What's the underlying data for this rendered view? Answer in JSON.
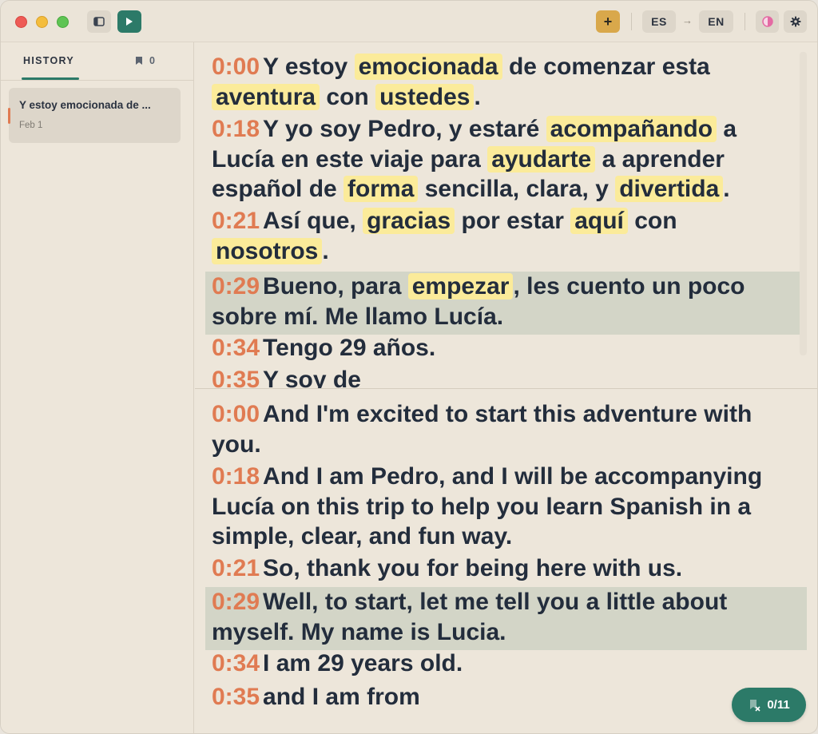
{
  "toolbar": {
    "source_lang": "ES",
    "arrow": "→",
    "target_lang": "EN",
    "add_label": "+",
    "accent": "#2c7a68",
    "add_color": "#d9a84b"
  },
  "sidebar": {
    "tab_history": "HISTORY",
    "bookmark_count": "0",
    "history": [
      {
        "title": "Y estoy emocionada de ...",
        "date": "Feb 1"
      }
    ]
  },
  "transcript": {
    "timestamp_color": "#e07b52",
    "highlight_color": "#fbeb9a",
    "spanish": [
      {
        "time": "0:00",
        "parts": [
          {
            "text": "Y estoy "
          },
          {
            "text": "emocionada",
            "hl": true
          },
          {
            "text": " de comenzar esta "
          },
          {
            "text": "aventura",
            "hl": true
          },
          {
            "text": " con "
          },
          {
            "text": "ustedes",
            "hl": true
          },
          {
            "text": "."
          }
        ]
      },
      {
        "time": "0:18",
        "parts": [
          {
            "text": "Y yo soy Pedro, y estaré "
          },
          {
            "text": "acompañando",
            "hl": true
          },
          {
            "text": " a Lucía en este viaje para "
          },
          {
            "text": "ayudarte",
            "hl": true
          },
          {
            "text": " a aprender español de "
          },
          {
            "text": "forma",
            "hl": true
          },
          {
            "text": " sencilla, clara, y "
          },
          {
            "text": "divertida",
            "hl": true
          },
          {
            "text": "."
          }
        ]
      },
      {
        "time": "0:21",
        "parts": [
          {
            "text": "Así que, "
          },
          {
            "text": "gracias",
            "hl": true
          },
          {
            "text": " por estar "
          },
          {
            "text": "aquí",
            "hl": true
          },
          {
            "text": " con "
          },
          {
            "text": "nosotros",
            "hl": true
          },
          {
            "text": "."
          }
        ]
      },
      {
        "time": "0:29",
        "active": true,
        "parts": [
          {
            "text": "Bueno, para "
          },
          {
            "text": "empezar",
            "hl": true
          },
          {
            "text": ", les cuento un poco sobre mí. Me llamo Lucía."
          }
        ]
      },
      {
        "time": "0:34",
        "parts": [
          {
            "text": "Tengo 29 años."
          }
        ]
      },
      {
        "time": "0:35",
        "parts": [
          {
            "text": "Y soy de"
          }
        ]
      }
    ],
    "english": [
      {
        "time": "0:00",
        "text": "And I'm excited to start this adventure with you."
      },
      {
        "time": "0:18",
        "text": "And I am Pedro, and I will be accompanying Lucía on this trip to help you learn Spanish in a simple, clear, and fun way."
      },
      {
        "time": "0:21",
        "text": "So, thank you for being here with us."
      },
      {
        "time": "0:29",
        "text": "Well, to start, let me tell you a little about myself. My name is Lucia.",
        "active": true
      },
      {
        "time": "0:34",
        "text": "I am 29 years old."
      },
      {
        "time": "0:35",
        "text": "and I am from"
      }
    ]
  },
  "counter": {
    "label": "0/11"
  }
}
